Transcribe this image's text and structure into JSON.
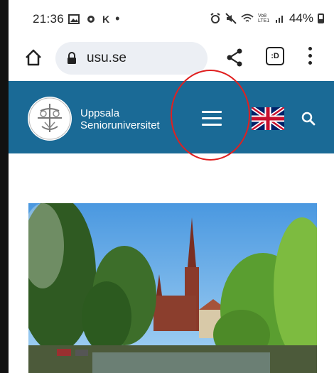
{
  "status_bar": {
    "time": "21:36",
    "left_icons": [
      "gallery-icon",
      "settings-icon",
      "k-icon",
      "dot-icon"
    ],
    "right_icons": [
      "alarm-icon",
      "mute-icon",
      "wifi-icon",
      "volte-icon",
      "signal-icon"
    ],
    "volte_label": "Vo8 LTE1",
    "battery": "44%"
  },
  "browser": {
    "url": "usu.se",
    "tabs_label": ":D"
  },
  "site_header": {
    "name_line1": "Uppsala",
    "name_line2": "Senioruniversitet",
    "background": "#1a6a96"
  },
  "annotation": {
    "color": "#e02020"
  },
  "hero": {
    "description_icon": "photo-uppsala-cathedral"
  }
}
